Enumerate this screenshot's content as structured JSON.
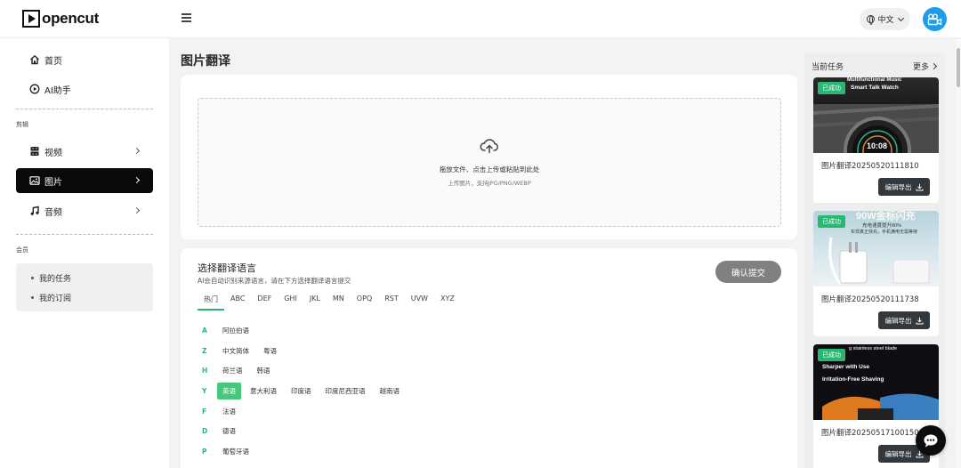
{
  "header": {
    "logo_text": "opencut",
    "lang_label": "中文"
  },
  "sidebar": {
    "top_items": [
      {
        "label": "首页",
        "icon": "home-icon"
      },
      {
        "label": "AI助手",
        "icon": "play-circle-icon"
      }
    ],
    "edit_section_label": "剪辑",
    "edit_items": [
      {
        "label": "视频",
        "icon": "film-icon"
      },
      {
        "label": "图片",
        "icon": "image-icon",
        "active": true
      },
      {
        "label": "音频",
        "icon": "music-icon"
      }
    ],
    "member_section_label": "会员",
    "member_items": [
      "我的任务",
      "我的订阅"
    ]
  },
  "main": {
    "page_title": "图片翻译",
    "upload": {
      "main_text": "拖放文件、点击上传或粘贴到此处",
      "sub_text": "上传图片，支持JPG/PNG/WEBP"
    },
    "language": {
      "title": "选择翻译语言",
      "desc": "AI会自动识别来源语言，请在下方选择翻译语言提交",
      "submit_label": "确认提交",
      "tabs": [
        "热门",
        "ABC",
        "DEF",
        "GHI",
        "JKL",
        "MN",
        "OPQ",
        "RST",
        "UVW",
        "XYZ"
      ],
      "active_tab": "热门",
      "rows": [
        {
          "letter": "A",
          "langs": [
            "阿拉伯语"
          ]
        },
        {
          "letter": "Z",
          "langs": [
            "中文简体",
            "粤语"
          ]
        },
        {
          "letter": "H",
          "langs": [
            "荷兰语",
            "韩语"
          ]
        },
        {
          "letter": "Y",
          "langs": [
            "英语",
            "意大利语",
            "印度语",
            "印度尼西亚语",
            "越南语"
          ],
          "selected": "英语"
        },
        {
          "letter": "F",
          "langs": [
            "法语"
          ]
        },
        {
          "letter": "D",
          "langs": [
            "德语"
          ]
        },
        {
          "letter": "P",
          "langs": [
            "葡萄牙语"
          ]
        }
      ]
    }
  },
  "right_panel": {
    "title": "当前任务",
    "more_label": "更多",
    "tasks": [
      {
        "badge": "已成功",
        "name": "图片翻译20250520111810",
        "export_label": "编辑导出",
        "thumb_lines": [
          "Multifunctional Music",
          "Smart Talk Watch"
        ]
      },
      {
        "badge": "已成功",
        "name": "图片翻译20250520111738",
        "export_label": "编辑导出",
        "thumb_lines": [
          "90W金标闪充",
          "充电速度提升80%",
          "实现真正快充，手机满电无需等待"
        ]
      },
      {
        "badge": "已成功",
        "name": "图片翻译20250517100150",
        "export_label": "编辑导出",
        "thumb_lines": [
          "g stainless steel blade",
          "Sharper with Use",
          "Irritation-Free Shaving"
        ]
      }
    ]
  },
  "colors": {
    "accent_green": "#2bb673",
    "active_nav_bg": "#0a0a0a",
    "avatar_blue": "#1f9be8"
  }
}
